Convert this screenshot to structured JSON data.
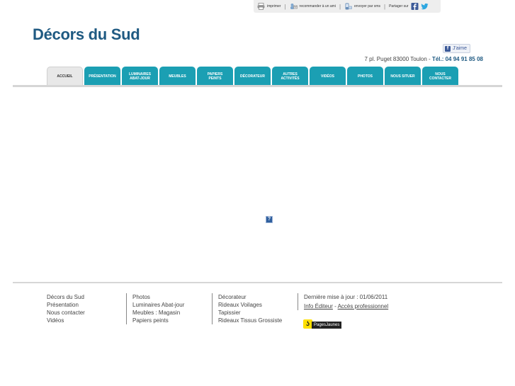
{
  "toolbar": {
    "print_label": "imprimer",
    "recommend_label": "recommander à un ami",
    "send_label": "envoyer par sms",
    "share_label": "Partager sur"
  },
  "header": {
    "site_title": "Décors du Sud",
    "like_label": "J'aime",
    "address": "7 pl. Puget 83000 Toulon",
    "tel_label": "Tél.: 04 94 91 85 08"
  },
  "nav": {
    "tabs": [
      {
        "label": "ACCUEIL"
      },
      {
        "label": "PRÉSENTATION"
      },
      {
        "label": "LUMINAIRES\nABAT-JOUR"
      },
      {
        "label": "MEUBLES"
      },
      {
        "label": "PAPIERS\nPEINTS"
      },
      {
        "label": "DÉCORATEUR"
      },
      {
        "label": "AUTRES\nACTIVITÉS"
      },
      {
        "label": "VIDÉOS"
      },
      {
        "label": "PHOTOS"
      },
      {
        "label": "NOUS SITUER"
      },
      {
        "label": "NOUS\nCONTACTER"
      }
    ]
  },
  "footer": {
    "col1": [
      "Décors du Sud",
      "Présentation",
      "Nous contacter",
      "Vidéos"
    ],
    "col2": [
      "Photos",
      "Luminaires Abat-jour",
      "Meubles : Magasin",
      "Papiers peints"
    ],
    "col3": [
      "Décorateur",
      "Rideaux Voilages",
      "Tapissier",
      "Rideaux Tissus Grossiste"
    ],
    "last_update": "Dernière mise à jour : 01/06/2011",
    "info_editeur": "Info Éditeur",
    "link_sep": " - ",
    "acces_pro": "Accès professionnel",
    "pages_jaunes": "PagesJaunes"
  },
  "colors": {
    "brand_blue": "#1f5a82",
    "tab_teal": "#1b9fb3",
    "facebook": "#3b5998",
    "twitter": "#2ea7e0"
  }
}
